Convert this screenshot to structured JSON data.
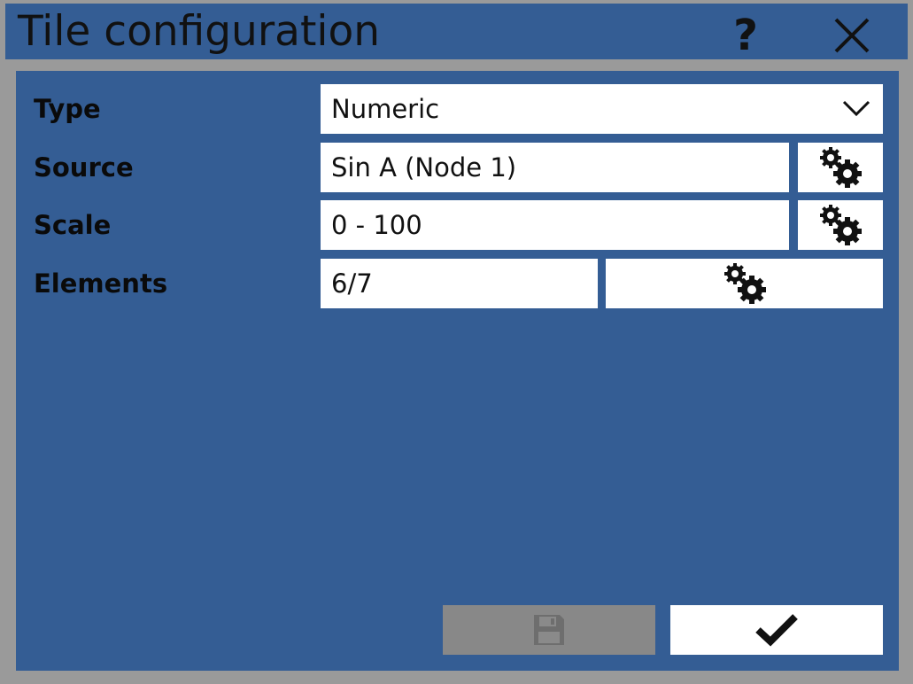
{
  "window": {
    "title": "Tile configuration",
    "help_label": "?",
    "close_icon": "close-icon"
  },
  "form": {
    "type": {
      "label": "Type",
      "value": "Numeric",
      "icon": "chevron-down-icon"
    },
    "source": {
      "label": "Source",
      "value": "Sin A (Node 1)",
      "icon": "gears-icon"
    },
    "scale": {
      "label": "Scale",
      "value": "0 - 100",
      "icon": "gears-icon"
    },
    "elements": {
      "label": "Elements",
      "value": "6/7",
      "icon": "gears-icon"
    }
  },
  "footer": {
    "save_icon": "save-icon",
    "save_enabled": false,
    "confirm_icon": "checkmark-icon"
  },
  "colors": {
    "panel_bg": "#345d94",
    "frame_bg": "#9a9a9a",
    "disabled_button": "#888888",
    "field_bg": "#ffffff"
  }
}
